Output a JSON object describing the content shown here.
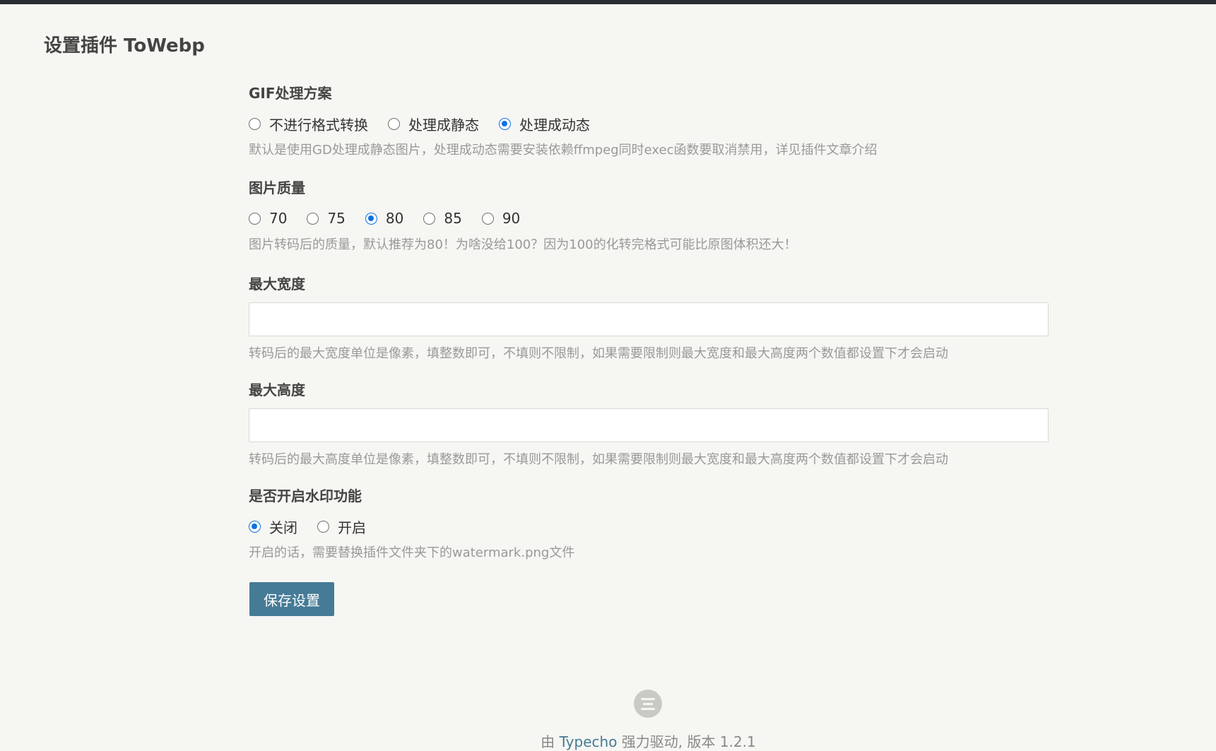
{
  "page_title": "设置插件 ToWebp",
  "gif": {
    "label": "GIF处理方案",
    "options": [
      "不进行格式转换",
      "处理成静态",
      "处理成动态"
    ],
    "selected": "处理成动态",
    "description": "默认是使用GD处理成静态图片，处理成动态需要安装依赖ffmpeg同时exec函数要取消禁用，详见插件文章介绍"
  },
  "quality": {
    "label": "图片质量",
    "options": [
      "70",
      "75",
      "80",
      "85",
      "90"
    ],
    "selected": "80",
    "description": "图片转码后的质量，默认推荐为80！为啥没给100？因为100的化转完格式可能比原图体积还大！"
  },
  "max_width": {
    "label": "最大宽度",
    "value": "",
    "description": "转码后的最大宽度单位是像素，填整数即可，不填则不限制，如果需要限制则最大宽度和最大高度两个数值都设置下才会启动"
  },
  "max_height": {
    "label": "最大高度",
    "value": "",
    "description": "转码后的最大高度单位是像素，填整数即可，不填则不限制，如果需要限制则最大宽度和最大高度两个数值都设置下才会启动"
  },
  "watermark": {
    "label": "是否开启水印功能",
    "options": [
      "关闭",
      "开启"
    ],
    "selected": "关闭",
    "description": "开启的话，需要替换插件文件夹下的watermark.png文件"
  },
  "save_label": "保存设置",
  "footer": {
    "prefix": "由 ",
    "link": "Typecho",
    "suffix": " 强力驱动, 版本 1.2.1"
  },
  "colors": {
    "accent": "#467b96",
    "radio_checked": "#0b72e0",
    "background": "#f6f6f3"
  }
}
